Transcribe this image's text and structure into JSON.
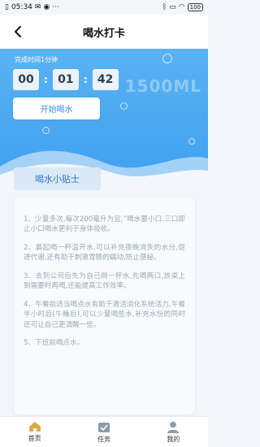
{
  "statusbar": {
    "time": "05:34",
    "extras": "⋯",
    "battery": "100"
  },
  "header": {
    "title": "喝水打卡"
  },
  "timer": {
    "label": "完成时间1分钟",
    "hours": "00",
    "minutes": "01",
    "seconds": "42",
    "sep": ":"
  },
  "capacity": "1500ML",
  "start_button": "开始喝水",
  "tips": {
    "tag": "喝水小贴士",
    "items": [
      "1、少量多次,每次200毫升为宜,”喝水要小口,三口即止小口喝水更利于身体吸收。",
      "2、晨起喝一杯温开水,可以补充夜晚流失的水分,促进代谢,还有助于刺激胃肠的蠕动,防止便秘。",
      "3、去到公司后先为自己倒一杯水,先喝两口,放桌上到需要时再喝,还能提高工作效率。",
      "4、午餐前适当喝点水有助于激活消化系统活力,午餐半小时后(午睡后),可以少量喝些水,补充水份的同时还可让自己更清醒一些。",
      "5、下班前喝点水。"
    ]
  },
  "tabbar": {
    "items": [
      {
        "label": "首页"
      },
      {
        "label": "任务"
      },
      {
        "label": "我的"
      }
    ]
  },
  "colors": {
    "accent": "#3ea0ef",
    "active_tab": "#d9a94f"
  }
}
